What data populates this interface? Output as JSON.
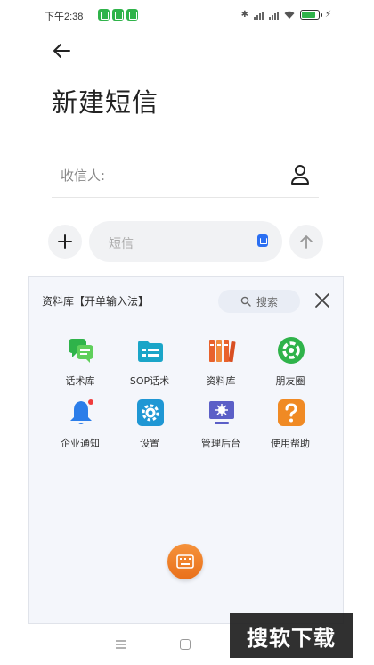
{
  "status_bar": {
    "time": "下午2:38",
    "battery_level": 0.9
  },
  "header": {
    "title": "新建短信"
  },
  "recipient": {
    "label": "收信人:"
  },
  "composer": {
    "placeholder": "短信"
  },
  "panel": {
    "title": "资料库【开单输入法】",
    "search_label": "搜索",
    "items": [
      {
        "label": "话术库",
        "icon": "chat-bubbles-icon",
        "color": "#2fb34a"
      },
      {
        "label": "SOP话术",
        "icon": "sop-folder-icon",
        "color": "#1aa5c8"
      },
      {
        "label": "资料库",
        "icon": "books-icon",
        "color": "#e8622c"
      },
      {
        "label": "朋友圈",
        "icon": "moments-icon",
        "color": "#2fb34a"
      },
      {
        "label": "企业通知",
        "icon": "bell-icon",
        "color": "#2b7de9"
      },
      {
        "label": "设置",
        "icon": "gear-icon",
        "color": "#1f97d4"
      },
      {
        "label": "管理后台",
        "icon": "monitor-icon",
        "color": "#5b5fc7"
      },
      {
        "label": "使用帮助",
        "icon": "help-icon",
        "color": "#f08a24"
      }
    ]
  },
  "watermark": {
    "text": "搜软下载"
  }
}
